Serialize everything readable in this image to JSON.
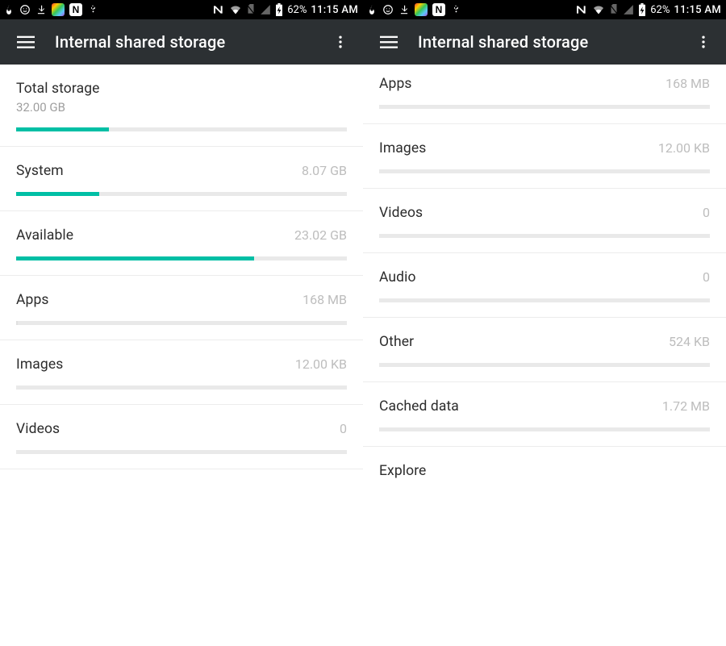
{
  "statusbar": {
    "battery_text": "62%",
    "time": "11:15 AM"
  },
  "toolbar": {
    "title": "Internal shared storage"
  },
  "storage": {
    "total": {
      "label": "Total storage",
      "sub": "32.00 GB"
    },
    "system": {
      "label": "System",
      "value": "8.07 GB"
    },
    "available": {
      "label": "Available",
      "value": "23.02 GB"
    },
    "apps": {
      "label": "Apps",
      "value": "168 MB"
    },
    "images": {
      "label": "Images",
      "value": "12.00 KB"
    },
    "videos": {
      "label": "Videos",
      "value": "0"
    },
    "audio": {
      "label": "Audio",
      "value": "0"
    },
    "other": {
      "label": "Other",
      "value": "524 KB"
    },
    "cached": {
      "label": "Cached data",
      "value": "1.72 MB"
    },
    "explore": {
      "label": "Explore"
    }
  }
}
